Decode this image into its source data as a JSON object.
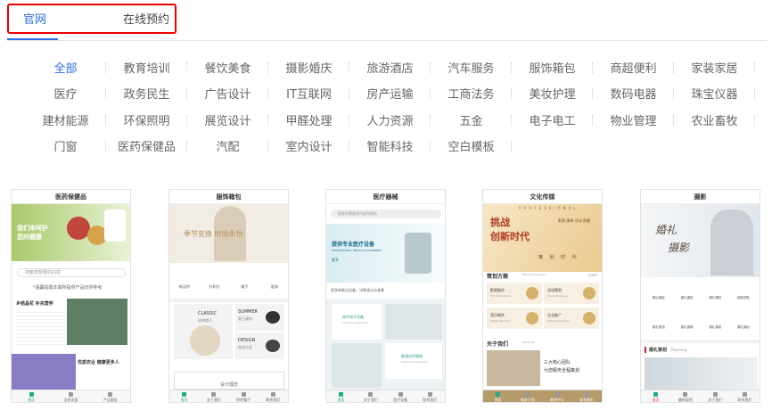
{
  "tabs": {
    "official": "官网",
    "booking": "在线预约"
  },
  "categories": [
    [
      "全部",
      "教育培训",
      "餐饮美食",
      "摄影婚庆",
      "旅游酒店",
      "汽车服务",
      "服饰箱包",
      "商超便利",
      "家装家居"
    ],
    [
      "医疗",
      "政务民生",
      "广告设计",
      "IT互联网",
      "房产运输",
      "工商法务",
      "美妆护理",
      "数码电器",
      "珠宝仪器"
    ],
    [
      "建材能源",
      "环保照明",
      "展览设计",
      "甲醛处理",
      "人力资源",
      "五金",
      "电子电工",
      "物业管理",
      "农业畜牧"
    ],
    [
      "门窗",
      "医药保健品",
      "汽配",
      "室内设计",
      "智能科技",
      "空白模板"
    ]
  ],
  "cards": [
    {
      "title": "医药保健品",
      "hero1": "我们来呵护",
      "hero2": "您的健康",
      "search": "搜索您想要的内容",
      "line": "*温馨提醒本期所提供产品仅供参考",
      "h1": "乡结晶花 补充营养",
      "h2": "优质农业 健康更多人",
      "nav": [
        "首页",
        "全家关爱",
        "产品服务"
      ]
    },
    {
      "title": "服饰箱包",
      "hero": "季节变换  时尚永恒",
      "icons": [
        "新品特",
        "针织衫",
        "帽子",
        "配饰"
      ],
      "p1a": "CLASSIC",
      "p1b": "经典帽子",
      "p2a": "SUMMER",
      "p2b": "夏日清凉",
      "p3a": "DESIGN",
      "p3b": "休闲方案",
      "foot": "设计理念",
      "nav": [
        "首页",
        "关于我们",
        "你的帽子",
        "联系我们"
      ]
    },
    {
      "title": "医疗器械",
      "search": "搜索你需要的内容和服务",
      "hero1": "提供专业医疗设备",
      "hero2": "PROFESSIONAL MEDICAL EQUIPMENT",
      "hero3": "更多",
      "notice": "更多新推出设备，详情请点击查看",
      "b1": "医疗电子设备",
      "b1s": "Medical equipment",
      "b2": "普通诊疗器械",
      "b2s": "Ordinary equipment",
      "nav": [
        "首页",
        "关于我们",
        "医疗设备",
        "联系我们"
      ]
    },
    {
      "title": "文化传媒",
      "brand": "PROFESSIONAL",
      "hero1": "挑战",
      "hero2": "创新时代",
      "hero3": "影视·演绎·活动·直播",
      "hero4": "策 划 时 代",
      "section1": "策划方案",
      "section1en": "Planning Program",
      "more": "more",
      "items": [
        "影视制作",
        "活动策划",
        "音乐制作",
        "企业推广"
      ],
      "itemsEn": [
        "Film Production",
        "Event Planning",
        "Master Record",
        "Enterprise Video"
      ],
      "section2": "关于我们",
      "section2en": "About Us",
      "about1": "三大核心团队",
      "about2": "为您服务全程策划",
      "nav": [
        "首页",
        "服务介绍",
        "新闻中心",
        "联系我们"
      ]
    },
    {
      "title": "摄影",
      "hero1": "婚礼",
      "hero2": "摄影",
      "icons": [
        "婚纱摄影",
        "婚礼摄影",
        "婚礼跟拍",
        "摄影团队",
        "婚礼策划",
        "婚礼摄像",
        "婚礼摄影",
        "婚礼婚纱"
      ],
      "section": "婚礼策划",
      "sectionen": "Planning",
      "nav": [
        "首页",
        "最新案例",
        "关于我们",
        "联系我们"
      ]
    }
  ],
  "colors": {
    "accent": "#2a6ee6",
    "outline": "#e00"
  }
}
